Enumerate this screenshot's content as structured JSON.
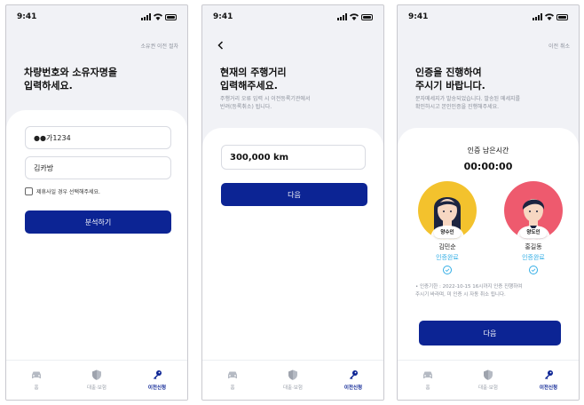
{
  "status_time": "9:41",
  "tabs": [
    {
      "label": "홈"
    },
    {
      "label": "대출·보험"
    },
    {
      "label": "이전신청"
    }
  ],
  "screen1": {
    "toplink": "소유권 이전 절차",
    "title": "차량번호와 소유자명을\n입력하세요.",
    "plate_value": "●●가1234",
    "owner_value": "김카방",
    "checkbox_label": "제휴사일 경우 선택해주세요.",
    "button_label": "분석하기"
  },
  "screen2": {
    "title": "현재의 주행거리\n입력해주세요.",
    "subtitle": "주행거리 오류 입력 시 이전등록기관에서\n반려(등록취소) 됩니다.",
    "mileage_value": "300,000 km",
    "button_label": "다음"
  },
  "screen3": {
    "toplink": "이전 취소",
    "title": "인증을 진행하여\n주시기 바랍니다.",
    "subtitle": "문자메세지가 발송되었습니다. 발송된 메세지를\n확인하시고 본인인증을 진행해주세요.",
    "timer_label": "인증 남은시간",
    "timer_value": "00:00:00",
    "parties": [
      {
        "role": "양수인",
        "name": "김민순",
        "status": "인증완료",
        "color": "#f3c22d"
      },
      {
        "role": "양도인",
        "name": "홍길동",
        "status": "인증완료",
        "color": "#ee5a6e"
      }
    ],
    "notice": "• 인증기한 : 2022-10-15 16시까지 인증 진행하여\n주시기 바라며, 미 인증 시 자동 취소 됩니다.",
    "button_label": "다음"
  },
  "colors": {
    "primary": "#0c2494",
    "verified": "#33aee6"
  }
}
